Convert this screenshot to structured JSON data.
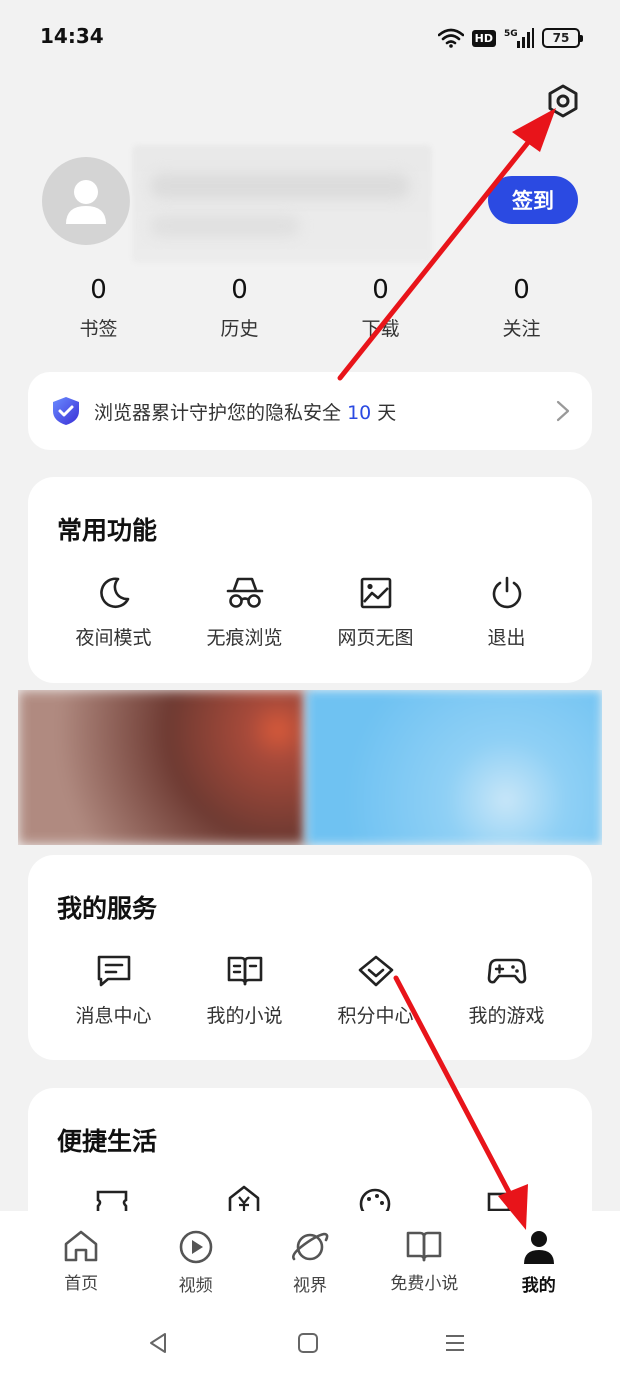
{
  "status": {
    "time": "14:34",
    "network": "HD",
    "signal_label": "5G",
    "battery": "75"
  },
  "header": {
    "settings_icon": "hexagon-settings-icon"
  },
  "profile": {
    "signin_label": "签到"
  },
  "stats": [
    {
      "count": "0",
      "label": "书签"
    },
    {
      "count": "0",
      "label": "历史"
    },
    {
      "count": "0",
      "label": "下载"
    },
    {
      "count": "0",
      "label": "关注"
    }
  ],
  "privacy": {
    "text": "浏览器累计守护您的隐私安全",
    "days": "10",
    "unit": "天"
  },
  "common": {
    "title": "常用功能",
    "items": [
      {
        "label": "夜间模式",
        "icon": "moon-icon"
      },
      {
        "label": "无痕浏览",
        "icon": "incognito-icon"
      },
      {
        "label": "网页无图",
        "icon": "image-icon"
      },
      {
        "label": "退出",
        "icon": "power-icon"
      }
    ]
  },
  "services": {
    "title": "我的服务",
    "items": [
      {
        "label": "消息中心",
        "icon": "message-icon"
      },
      {
        "label": "我的小说",
        "icon": "book-icon"
      },
      {
        "label": "积分中心",
        "icon": "diamond-icon"
      },
      {
        "label": "我的游戏",
        "icon": "gamepad-icon"
      }
    ]
  },
  "life": {
    "title": "便捷生活"
  },
  "tabs": [
    {
      "label": "首页",
      "icon": "home-icon"
    },
    {
      "label": "视频",
      "icon": "play-icon"
    },
    {
      "label": "视界",
      "icon": "planet-icon"
    },
    {
      "label": "免费小说",
      "icon": "open-book-icon"
    },
    {
      "label": "我的",
      "icon": "user-icon",
      "active": true
    }
  ],
  "colors": {
    "accent": "#2b4ae2",
    "arrow": "#e8141a",
    "background": "#f2f2f2"
  }
}
